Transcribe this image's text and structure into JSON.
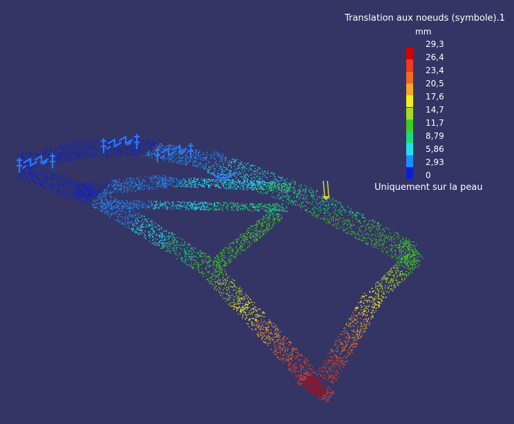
{
  "legend": {
    "title": "Translation aux noeuds (symbole).1",
    "unit": "mm",
    "footer": "Uniquement sur la peau",
    "ticks": [
      "29,3",
      "26,4",
      "23,4",
      "20,5",
      "17,6",
      "14,7",
      "11,7",
      "8,79",
      "5,86",
      "2,93",
      "0"
    ],
    "colors": [
      "#d40000",
      "#f23a1a",
      "#f46a22",
      "#f7a829",
      "#f2ee22",
      "#a6dc1e",
      "#3fcb1f",
      "#1fd77c",
      "#22dfe8",
      "#1d8dff",
      "#0b1fd0"
    ]
  },
  "scene": {
    "background": "#343565",
    "clamp_color": "#2b78ff",
    "load_arrow_color": "#d8d23a",
    "displacement_max_mm": 29.3
  }
}
